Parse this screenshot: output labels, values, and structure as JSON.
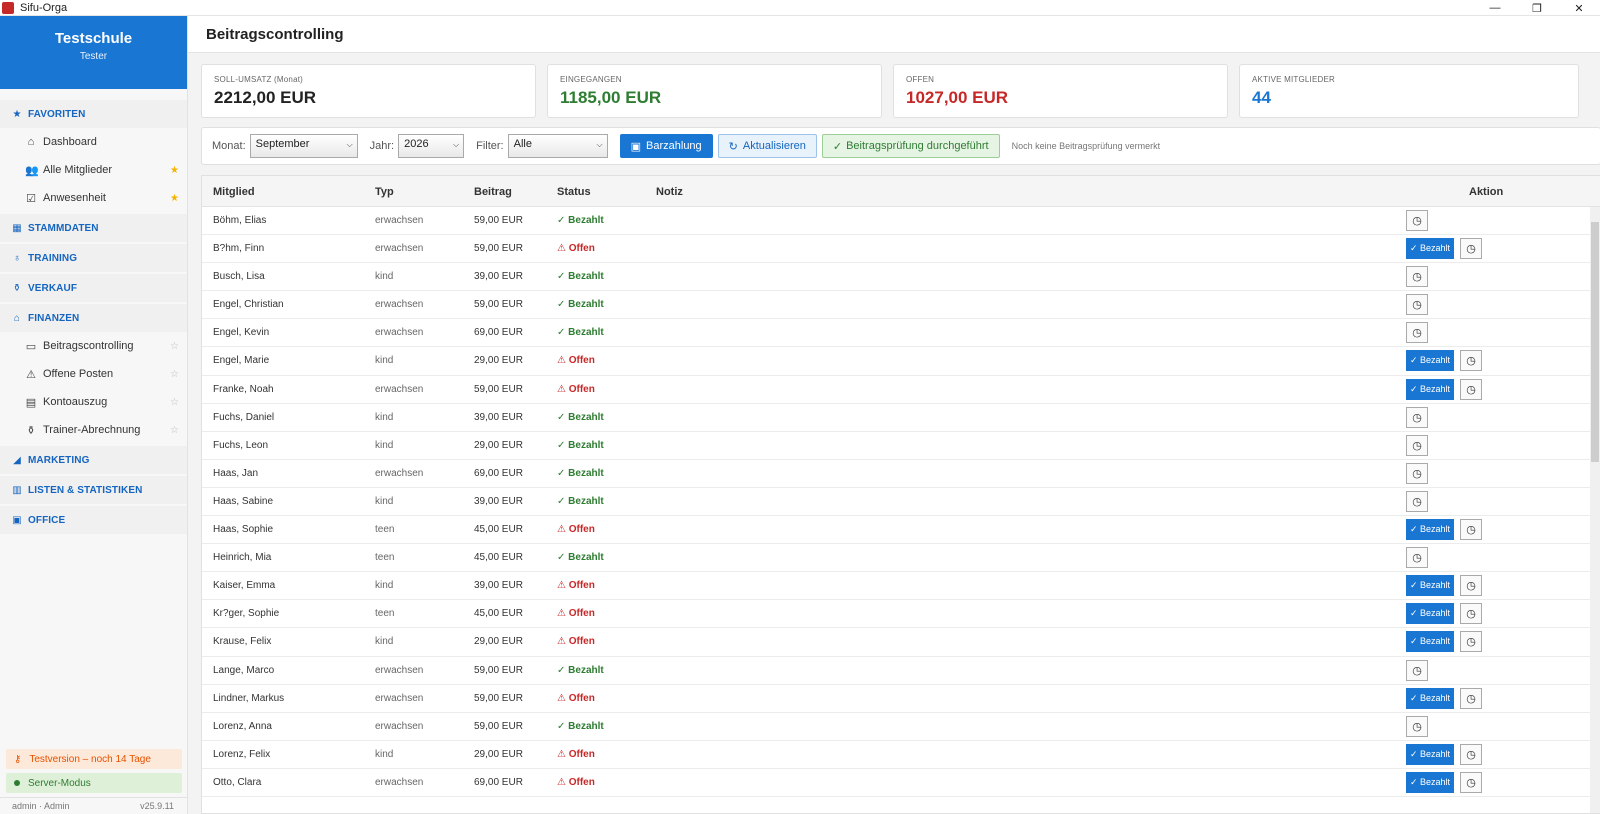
{
  "window": {
    "title": "Sifu-Orga",
    "minimize": "—",
    "maximize": "❐",
    "close": "✕"
  },
  "sidebar": {
    "school": "Testschule",
    "user": "Tester",
    "favorites": {
      "label": "FAVORITEN",
      "items": [
        {
          "label": "Dashboard",
          "icon": "home-icon",
          "glyph": "⌂",
          "star": ""
        },
        {
          "label": "Alle Mitglieder",
          "icon": "users-icon",
          "glyph": "👥",
          "star": "★"
        },
        {
          "label": "Anwesenheit",
          "icon": "checkbox-icon",
          "glyph": "☑",
          "star": "★"
        }
      ]
    },
    "sections": {
      "stammdaten": "STAMMDATEN",
      "training": "TRAINING",
      "verkauf": "VERKAUF",
      "finanzen": "FINANZEN",
      "marketing": "MARKETING",
      "listen": "LISTEN & STATISTIKEN",
      "office": "OFFICE"
    },
    "finanzen_items": [
      {
        "label": "Beitragscontrolling",
        "icon": "card-icon",
        "glyph": "▭",
        "star": "☆"
      },
      {
        "label": "Offene Posten",
        "icon": "warning-icon",
        "glyph": "⚠",
        "star": "☆"
      },
      {
        "label": "Kontoauszug",
        "icon": "statement-icon",
        "glyph": "▤",
        "star": "☆"
      },
      {
        "label": "Trainer-Abrechnung",
        "icon": "money-bag-icon",
        "glyph": "⚱",
        "star": "☆"
      }
    ],
    "trial": "Testversion – noch 14 Tage",
    "server": "Server-Modus",
    "login": "admin · Admin",
    "version": "v25.9.11"
  },
  "page": {
    "title": "Beitragscontrolling"
  },
  "cards": {
    "soll": {
      "label": "SOLL-UMSATZ (Monat)",
      "value": "2212,00 EUR"
    },
    "eingegangen": {
      "label": "EINGEGANGEN",
      "value": "1185,00 EUR"
    },
    "offen": {
      "label": "OFFEN",
      "value": "1027,00 EUR"
    },
    "aktiv": {
      "label": "AKTIVE MITGLIEDER",
      "value": "44"
    }
  },
  "colors": {
    "accent": "#1976d2",
    "paid": "#2e7d32",
    "open": "#c62828"
  },
  "toolbar": {
    "month_label": "Monat:",
    "month_value": "September",
    "year_label": "Jahr:",
    "year_value": "2026",
    "filter_label": "Filter:",
    "filter_value": "Alle",
    "cash_button": "Barzahlung",
    "refresh_button": "Aktualisieren",
    "check_button": "Beitragsprüfung durchgeführt",
    "check_note": "Noch keine Beitragsprüfung vermerkt"
  },
  "table": {
    "headers": {
      "member": "Mitglied",
      "type": "Typ",
      "fee": "Beitrag",
      "status": "Status",
      "note": "Notiz",
      "action": "Aktion"
    },
    "paid_label": "✓ Bezahlt",
    "open_label": "⚠ Offen",
    "mark_paid_label": "✓ Bezahlt",
    "rows": [
      {
        "member": "Böhm, Elias",
        "type": "erwachsen",
        "fee": "59,00 EUR",
        "status": "paid"
      },
      {
        "member": "B?hm, Finn",
        "type": "erwachsen",
        "fee": "59,00 EUR",
        "status": "open"
      },
      {
        "member": "Busch, Lisa",
        "type": "kind",
        "fee": "39,00 EUR",
        "status": "paid"
      },
      {
        "member": "Engel, Christian",
        "type": "erwachsen",
        "fee": "59,00 EUR",
        "status": "paid"
      },
      {
        "member": "Engel, Kevin",
        "type": "erwachsen",
        "fee": "69,00 EUR",
        "status": "paid"
      },
      {
        "member": "Engel, Marie",
        "type": "kind",
        "fee": "29,00 EUR",
        "status": "open"
      },
      {
        "member": "Franke, Noah",
        "type": "erwachsen",
        "fee": "59,00 EUR",
        "status": "open"
      },
      {
        "member": "Fuchs, Daniel",
        "type": "kind",
        "fee": "39,00 EUR",
        "status": "paid"
      },
      {
        "member": "Fuchs, Leon",
        "type": "kind",
        "fee": "29,00 EUR",
        "status": "paid"
      },
      {
        "member": "Haas, Jan",
        "type": "erwachsen",
        "fee": "69,00 EUR",
        "status": "paid"
      },
      {
        "member": "Haas, Sabine",
        "type": "kind",
        "fee": "39,00 EUR",
        "status": "paid"
      },
      {
        "member": "Haas, Sophie",
        "type": "teen",
        "fee": "45,00 EUR",
        "status": "open"
      },
      {
        "member": "Heinrich, Mia",
        "type": "teen",
        "fee": "45,00 EUR",
        "status": "paid"
      },
      {
        "member": "Kaiser, Emma",
        "type": "kind",
        "fee": "39,00 EUR",
        "status": "open"
      },
      {
        "member": "Kr?ger, Sophie",
        "type": "teen",
        "fee": "45,00 EUR",
        "status": "open"
      },
      {
        "member": "Krause, Felix",
        "type": "kind",
        "fee": "29,00 EUR",
        "status": "open"
      },
      {
        "member": "Lange, Marco",
        "type": "erwachsen",
        "fee": "59,00 EUR",
        "status": "paid"
      },
      {
        "member": "Lindner, Markus",
        "type": "erwachsen",
        "fee": "59,00 EUR",
        "status": "open"
      },
      {
        "member": "Lorenz, Anna",
        "type": "erwachsen",
        "fee": "59,00 EUR",
        "status": "paid"
      },
      {
        "member": "Lorenz, Felix",
        "type": "kind",
        "fee": "29,00 EUR",
        "status": "open"
      },
      {
        "member": "Otto, Clara",
        "type": "erwachsen",
        "fee": "69,00 EUR",
        "status": "open"
      }
    ]
  }
}
